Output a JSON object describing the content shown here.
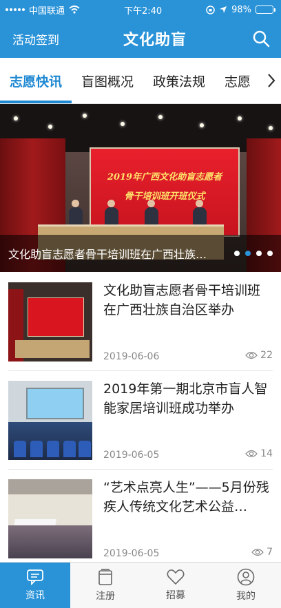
{
  "status_bar": {
    "carrier": "中国联通",
    "time": "下午2:40",
    "battery": "98%",
    "battery_level": 0.98
  },
  "header": {
    "left_label": "活动签到",
    "title": "文化助盲",
    "search_icon": "search-icon"
  },
  "tabs": [
    {
      "label": "志愿快讯",
      "active": true
    },
    {
      "label": "盲图概况",
      "active": false
    },
    {
      "label": "政策法规",
      "active": false
    },
    {
      "label": "志愿",
      "active": false
    }
  ],
  "banner": {
    "caption": "文化助盲志愿者骨干培训班在广西壮族…",
    "screen_line1": "2019年广西文化助盲志愿者",
    "screen_line2": "骨干培训班开班仪式",
    "slide_count": 4,
    "active_slide": 2
  },
  "news": [
    {
      "title": "文化助盲志愿者骨干培训班在广西壮族自治区举办",
      "date": "2019-06-06",
      "views": "22"
    },
    {
      "title": "2019年第一期北京市盲人智能家居培训班成功举办",
      "date": "2019-06-05",
      "views": "14"
    },
    {
      "title": "“艺术点亮人生”——5月份残疾人传统文化艺术公益…",
      "date": "2019-06-05",
      "views": "7"
    }
  ],
  "bottom_nav": [
    {
      "label": "资讯",
      "icon": "chat-icon",
      "active": true
    },
    {
      "label": "注册",
      "icon": "document-icon",
      "active": false
    },
    {
      "label": "招募",
      "icon": "heart-icon",
      "active": false
    },
    {
      "label": "我的",
      "icon": "user-icon",
      "active": false
    }
  ],
  "colors": {
    "primary": "#2a93d8",
    "active_tab": "#1f88d2"
  }
}
